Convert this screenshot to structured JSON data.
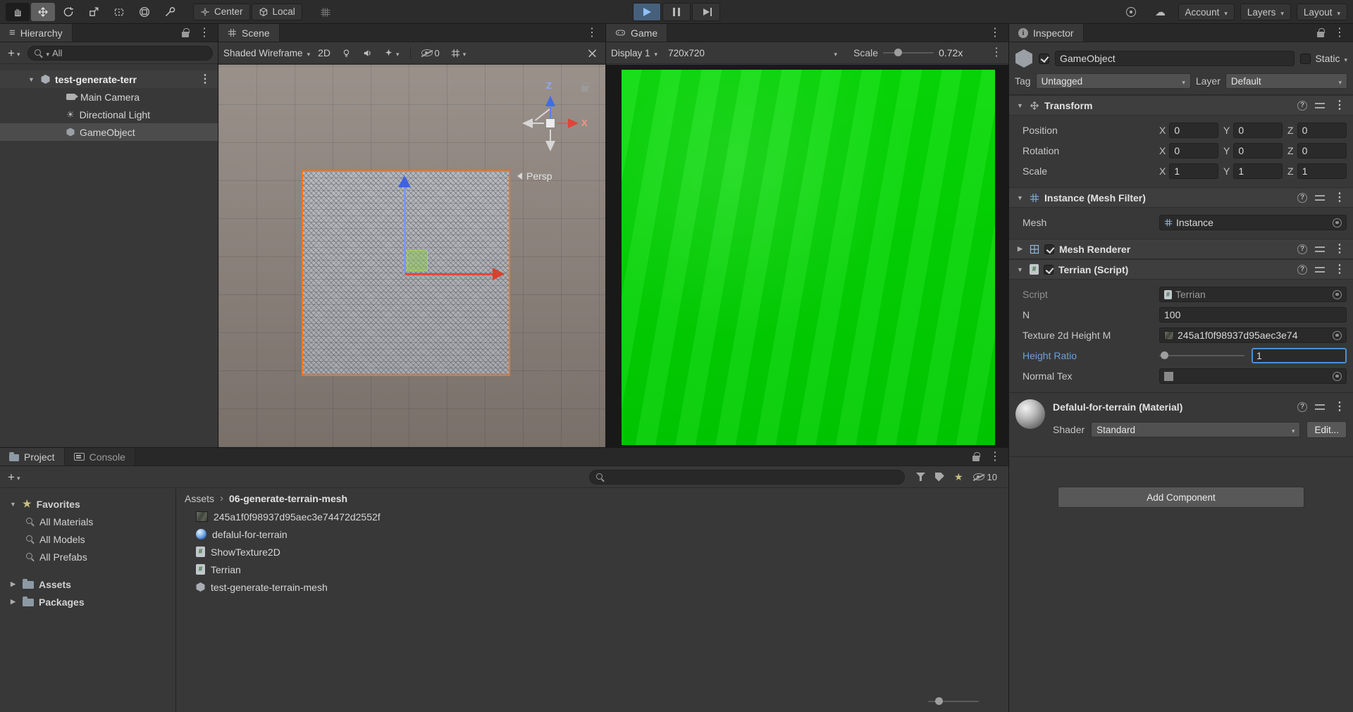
{
  "toolbar": {
    "center": "Center",
    "local": "Local",
    "account": "Account",
    "layers": "Layers",
    "layout": "Layout"
  },
  "hierarchy": {
    "tab": "Hierarchy",
    "search_value": "All",
    "scene_name": "test-generate-terr",
    "items": [
      {
        "label": "Main Camera"
      },
      {
        "label": "Directional Light"
      },
      {
        "label": "GameObject"
      }
    ]
  },
  "scene_view": {
    "tab": "Scene",
    "draw_mode": "Shaded Wireframe",
    "toggle_2d": "2D",
    "hidden_count": "0",
    "persp_label": "Persp",
    "axis_z": "Z",
    "axis_x": "X"
  },
  "game_view": {
    "tab": "Game",
    "display": "Display 1",
    "resolution": "720x720",
    "scale_label": "Scale",
    "scale_value": "0.72x"
  },
  "inspector": {
    "tab": "Inspector",
    "gameobject": {
      "name": "GameObject",
      "static_label": "Static",
      "tag_label": "Tag",
      "tag_value": "Untagged",
      "layer_label": "Layer",
      "layer_value": "Default"
    },
    "transform": {
      "title": "Transform",
      "axis": {
        "x": "X",
        "y": "Y",
        "z": "Z"
      },
      "rows": [
        {
          "label": "Position",
          "x": "0",
          "y": "0",
          "z": "0"
        },
        {
          "label": "Rotation",
          "x": "0",
          "y": "0",
          "z": "0"
        },
        {
          "label": "Scale",
          "x": "1",
          "y": "1",
          "z": "1"
        }
      ]
    },
    "mesh_filter": {
      "title": "Instance (Mesh Filter)",
      "mesh_label": "Mesh",
      "mesh_value": "Instance"
    },
    "mesh_renderer": {
      "title": "Mesh Renderer"
    },
    "terrian": {
      "title": "Terrian (Script)",
      "script_label": "Script",
      "script_value": "Terrian",
      "n_label": "N",
      "n_value": "100",
      "texture_label": "Texture 2d Height M",
      "texture_value": "245a1f0f98937d95aec3e74",
      "height_ratio_label": "Height Ratio",
      "height_ratio_value": "1",
      "normal_tex_label": "Normal Tex"
    },
    "material": {
      "title": "Defalul-for-terrain (Material)",
      "shader_label": "Shader",
      "shader_value": "Standard",
      "edit_label": "Edit..."
    },
    "add_component": "Add Component"
  },
  "project": {
    "tab": "Project",
    "console_tab": "Console",
    "favorites_label": "Favorites",
    "favorites": [
      {
        "label": "All Materials"
      },
      {
        "label": "All Models"
      },
      {
        "label": "All Prefabs"
      }
    ],
    "folders": [
      {
        "label": "Assets"
      },
      {
        "label": "Packages"
      }
    ],
    "breadcrumb": {
      "root": "Assets",
      "current": "06-generate-terrain-mesh"
    },
    "files": [
      {
        "label": "245a1f0f98937d95aec3e74472d2552f"
      },
      {
        "label": "defalul-for-terrain"
      },
      {
        "label": "ShowTexture2D"
      },
      {
        "label": "Terrian"
      },
      {
        "label": "test-generate-terrain-mesh"
      }
    ],
    "hidden_count": "10"
  },
  "colors": {
    "accent_blue": "#4a90d9",
    "selection_gray": "#4c4c4c",
    "selection_orange": "#ff7519",
    "game_green": "#00d600",
    "axis_blue": "#3f6ce8",
    "axis_red": "#e04337",
    "height_ratio_label_blue": "#6f9edb"
  }
}
